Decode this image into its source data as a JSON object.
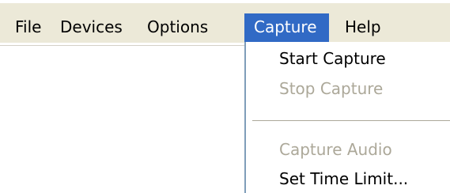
{
  "menubar": {
    "items": [
      {
        "label": "File"
      },
      {
        "label": "Devices"
      },
      {
        "label": "Options"
      },
      {
        "label": "Capture"
      },
      {
        "label": "Help"
      }
    ],
    "active_index": 3
  },
  "capture_menu": {
    "items": [
      {
        "label": "Start Capture",
        "enabled": true
      },
      {
        "label": "Stop Capture",
        "enabled": false
      },
      {
        "label": "Capture Audio",
        "enabled": false
      },
      {
        "label": "Set Time Limit...",
        "enabled": true
      }
    ]
  },
  "colors": {
    "menubar_bg": "#ece9d8",
    "highlight_bg": "#316ac5",
    "highlight_text": "#ffffff",
    "disabled_text": "#aca899"
  }
}
